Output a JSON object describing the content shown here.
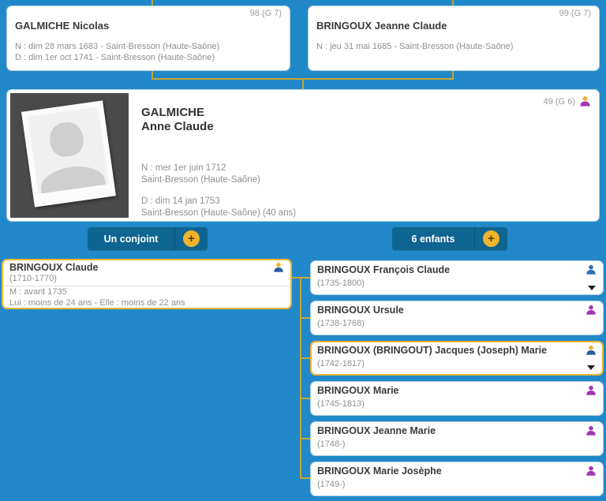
{
  "colors": {
    "background": "#2189c9",
    "button_blue": "#0f6591",
    "accent_yellow": "#f0b42c",
    "selected_border": "#f2b234",
    "connector_gold": "#c7a62f",
    "male_icon": "#2e6db6",
    "female_icon": "#a136b4",
    "sosa_head": "#f2b32c"
  },
  "parents": [
    {
      "id": "98 (G 7)",
      "name": "GALMICHE Nicolas",
      "detail1": "N : dim 28 mars 1683 - Saint-Bresson (Haute-Saône)",
      "detail2": "D : dim 1er oct 1741 - Saint-Bresson (Haute-Saône)"
    },
    {
      "id": "99 (G 7)",
      "name": "BRINGOUX Jeanne Claude",
      "detail1": "N : jeu 31 mai 1685 - Saint-Bresson (Haute-Saône)",
      "detail2": ""
    }
  ],
  "person": {
    "id": "49 (G 6)",
    "surname": "GALMICHE",
    "given": "Anne Claude",
    "birth_line1": "N : mer 1er juin 1712",
    "birth_line2": "Saint-Bresson (Haute-Saône)",
    "death_line1": "D : dim 14 jan 1753",
    "death_line2": "Saint-Bresson (Haute-Saône) (40 ans)"
  },
  "buttons": {
    "spouse_label": "Un conjoint",
    "children_label": "6 enfants",
    "add_label": "+"
  },
  "spouse": {
    "name": "BRINGOUX Claude",
    "dates": "(1710-1770)",
    "marriage": "M : avant 1735",
    "ages": "Lui : moins de 24 ans - Elle : moins de 22 ans"
  },
  "children": [
    {
      "name": "BRINGOUX François Claude",
      "dates": "(1735-1800)"
    },
    {
      "name": "BRINGOUX Ursule",
      "dates": "(1738-1768)"
    },
    {
      "name": "BRINGOUX (BRINGOUT) Jacques (Joseph) Marie",
      "dates": "(1742-1817)"
    },
    {
      "name": "BRINGOUX Marie",
      "dates": "(1745-1813)"
    },
    {
      "name": "BRINGOUX Jeanne Marie",
      "dates": "(1748-)"
    },
    {
      "name": "BRINGOUX Marie Josèphe",
      "dates": "(1749-)"
    }
  ]
}
